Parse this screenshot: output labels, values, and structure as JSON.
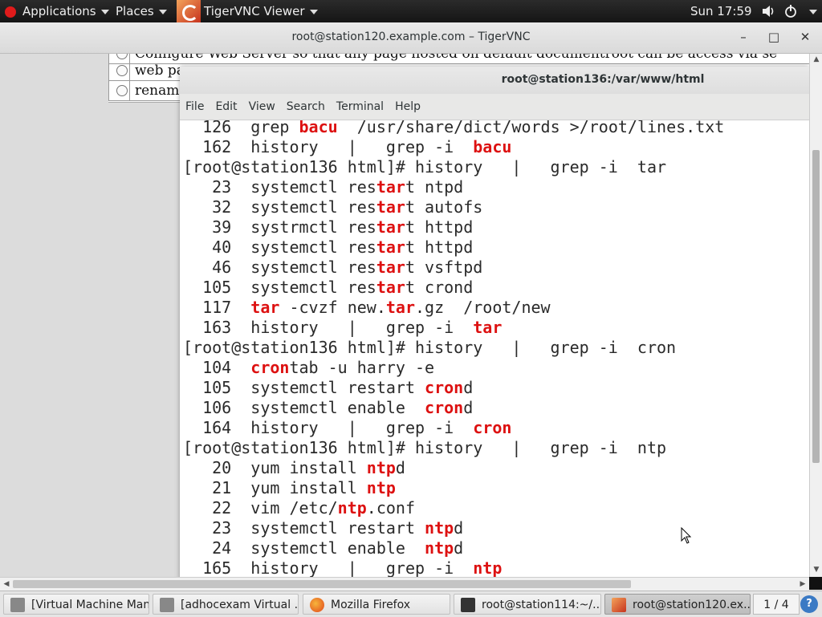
{
  "top_panel": {
    "applications": "Applications",
    "places": "Places",
    "active_app": "TigerVNC Viewer",
    "clock": "Sun 17:59"
  },
  "vnc_window": {
    "title": "root@station120.example.com – TigerVNC",
    "minimize": "–",
    "maximize": "□",
    "close": "✕"
  },
  "background_doc": {
    "rows": [
      "Configure Web Server so that any page hosted on default documentroot can be access via server...",
      "web pa",
      "renam"
    ]
  },
  "terminal": {
    "title": "root@station136:/var/www/html",
    "menu": [
      "File",
      "Edit",
      "View",
      "Search",
      "Terminal",
      "Help"
    ],
    "lines": [
      [
        [
          "  126  grep ",
          ""
        ],
        [
          "bacu",
          "hl"
        ],
        [
          "  /usr/share/dict/words >/root/lines.txt",
          ""
        ]
      ],
      [
        [
          "  162  history   |   grep -i  ",
          ""
        ],
        [
          "bacu",
          "hl"
        ]
      ],
      [
        [
          "[root@station136 html]# history   |   grep -i  tar",
          ""
        ]
      ],
      [
        [
          "   23  systemctl res",
          ""
        ],
        [
          "tar",
          "hl"
        ],
        [
          "t ntpd",
          ""
        ]
      ],
      [
        [
          "   32  systemctl res",
          ""
        ],
        [
          "tar",
          "hl"
        ],
        [
          "t autofs",
          ""
        ]
      ],
      [
        [
          "   39  systrmctl res",
          ""
        ],
        [
          "tar",
          "hl"
        ],
        [
          "t httpd",
          ""
        ]
      ],
      [
        [
          "   40  systemctl res",
          ""
        ],
        [
          "tar",
          "hl"
        ],
        [
          "t httpd",
          ""
        ]
      ],
      [
        [
          "   46  systemctl res",
          ""
        ],
        [
          "tar",
          "hl"
        ],
        [
          "t vsftpd",
          ""
        ]
      ],
      [
        [
          "  105  systemctl res",
          ""
        ],
        [
          "tar",
          "hl"
        ],
        [
          "t crond",
          ""
        ]
      ],
      [
        [
          "  117  ",
          ""
        ],
        [
          "tar",
          "hl"
        ],
        [
          " -cvzf new.",
          ""
        ],
        [
          "tar",
          "hl"
        ],
        [
          ".gz  /root/new",
          ""
        ]
      ],
      [
        [
          "  163  history   |   grep -i  ",
          ""
        ],
        [
          "tar",
          "hl"
        ]
      ],
      [
        [
          "[root@station136 html]# history   |   grep -i  cron",
          ""
        ]
      ],
      [
        [
          "  104  ",
          ""
        ],
        [
          "cron",
          "hl"
        ],
        [
          "tab -u harry -e",
          ""
        ]
      ],
      [
        [
          "  105  systemctl restart ",
          ""
        ],
        [
          "cron",
          "hl"
        ],
        [
          "d",
          ""
        ]
      ],
      [
        [
          "  106  systemctl enable  ",
          ""
        ],
        [
          "cron",
          "hl"
        ],
        [
          "d",
          ""
        ]
      ],
      [
        [
          "  164  history   |   grep -i  ",
          ""
        ],
        [
          "cron",
          "hl"
        ]
      ],
      [
        [
          "[root@station136 html]# history   |   grep -i  ntp",
          ""
        ]
      ],
      [
        [
          "   20  yum install ",
          ""
        ],
        [
          "ntp",
          "hl"
        ],
        [
          "d",
          ""
        ]
      ],
      [
        [
          "   21  yum install ",
          ""
        ],
        [
          "ntp",
          "hl"
        ]
      ],
      [
        [
          "   22  vim /etc/",
          ""
        ],
        [
          "ntp",
          "hl"
        ],
        [
          ".conf",
          ""
        ]
      ],
      [
        [
          "   23  systemctl restart ",
          ""
        ],
        [
          "ntp",
          "hl"
        ],
        [
          "d",
          ""
        ]
      ],
      [
        [
          "   24  systemctl enable  ",
          ""
        ],
        [
          "ntp",
          "hl"
        ],
        [
          "d",
          ""
        ]
      ],
      [
        [
          "  165  history   |   grep -i  ",
          ""
        ],
        [
          "ntp",
          "hl"
        ]
      ]
    ]
  },
  "taskbar": {
    "items": [
      {
        "label": "[Virtual Machine Man...",
        "icon": "virt-manager-icon",
        "active": false
      },
      {
        "label": "[adhocexam Virtual ...",
        "icon": "virt-manager-icon",
        "active": false
      },
      {
        "label": "Mozilla Firefox",
        "icon": "firefox-icon",
        "active": false
      },
      {
        "label": "root@station114:~/...",
        "icon": "terminal-icon",
        "active": false
      },
      {
        "label": "root@station120.ex...",
        "icon": "tigervnc-icon",
        "active": true
      }
    ],
    "workspace_pager": "1 / 4"
  },
  "colors": {
    "highlight": "#dd1111",
    "panel_bg": "#1e1e1e"
  }
}
